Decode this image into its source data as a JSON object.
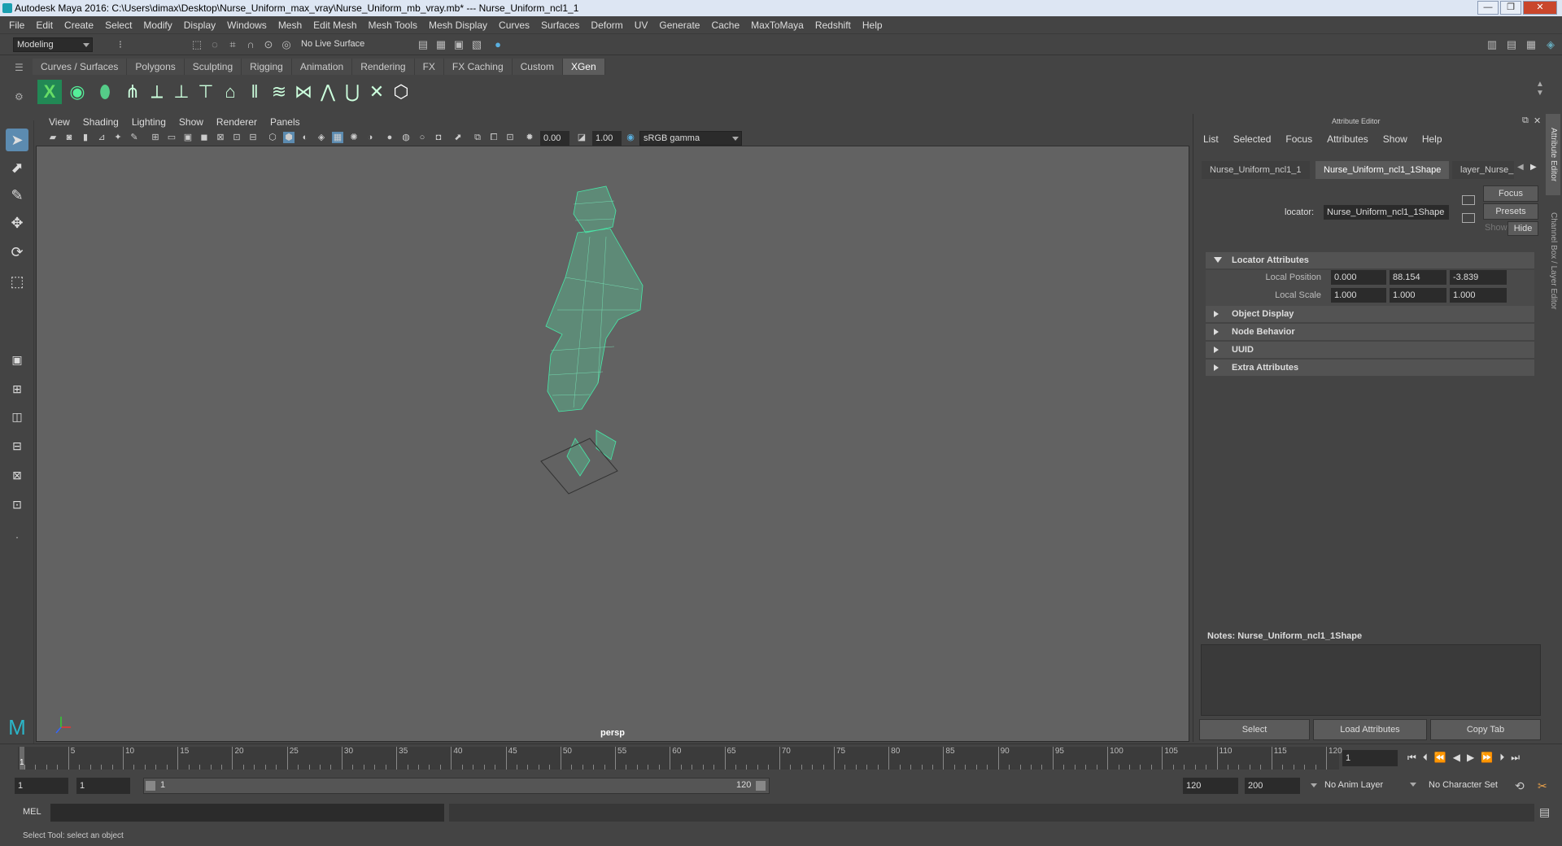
{
  "titlebar": {
    "title": "Autodesk Maya 2016: C:\\Users\\dimax\\Desktop\\Nurse_Uniform_max_vray\\Nurse_Uniform_mb_vray.mb*   ---   Nurse_Uniform_ncl1_1",
    "minimize": "—",
    "maximize": "❐",
    "close": "✕"
  },
  "menubar": {
    "items": [
      "File",
      "Edit",
      "Create",
      "Select",
      "Modify",
      "Display",
      "Windows",
      "Mesh",
      "Edit Mesh",
      "Mesh Tools",
      "Mesh Display",
      "Curves",
      "Surfaces",
      "Deform",
      "UV",
      "Generate",
      "Cache",
      "MaxToMaya",
      "Redshift",
      "Help"
    ]
  },
  "statusline": {
    "mode": "Modeling",
    "live_surface": "No Live Surface"
  },
  "shelf": {
    "tabs": [
      "Curves / Surfaces",
      "Polygons",
      "Sculpting",
      "Rigging",
      "Animation",
      "Rendering",
      "FX",
      "FX Caching",
      "Custom",
      "XGen"
    ],
    "active_tab": "XGen"
  },
  "viewport": {
    "menus": [
      "View",
      "Shading",
      "Lighting",
      "Show",
      "Renderer",
      "Panels"
    ],
    "exposure": "0.00",
    "gamma": "1.00",
    "colorspace": "sRGB gamma",
    "camera_label": "persp",
    "wire_color": "#3fe3a0"
  },
  "attribute_editor": {
    "title": "Attribute Editor",
    "menus": [
      "List",
      "Selected",
      "Focus",
      "Attributes",
      "Show",
      "Help"
    ],
    "tabs": [
      "Nurse_Uniform_ncl1_1",
      "Nurse_Uniform_ncl1_1Shape",
      "layer_Nurse_"
    ],
    "active_tab": "Nurse_Uniform_ncl1_1Shape",
    "node_type_label": "locator:",
    "node_name": "Nurse_Uniform_ncl1_1Shape",
    "focus_btn": "Focus",
    "presets_btn": "Presets",
    "show_btn": "Show",
    "hide_btn": "Hide",
    "sections": {
      "locator": "Locator Attributes",
      "local_position_label": "Local Position",
      "local_position": [
        "0.000",
        "88.154",
        "-3.839"
      ],
      "local_scale_label": "Local Scale",
      "local_scale": [
        "1.000",
        "1.000",
        "1.000"
      ],
      "collapsed": [
        "Object Display",
        "Node Behavior",
        "UUID",
        "Extra Attributes"
      ]
    },
    "notes_label": "Notes:  Nurse_Uniform_ncl1_1Shape",
    "buttons": [
      "Select",
      "Load Attributes",
      "Copy Tab"
    ],
    "side_tabs": [
      "Attribute Editor",
      "Channel Box / Layer Editor"
    ]
  },
  "timeline": {
    "ticks": [
      "5",
      "10",
      "15",
      "20",
      "25",
      "30",
      "35",
      "40",
      "45",
      "50",
      "55",
      "60",
      "65",
      "70",
      "75",
      "80",
      "85",
      "90",
      "95",
      "100",
      "105",
      "110",
      "115",
      "120"
    ],
    "current_marker": "1",
    "current_frame": "1"
  },
  "range": {
    "start": "1",
    "playback_start": "1",
    "slider_start": "1",
    "slider_end": "120",
    "playback_end": "120",
    "end": "200",
    "anim_layer": "No Anim Layer",
    "character_set": "No Character Set"
  },
  "command": {
    "label": "MEL"
  },
  "help": {
    "text": "Select Tool: select an object"
  }
}
